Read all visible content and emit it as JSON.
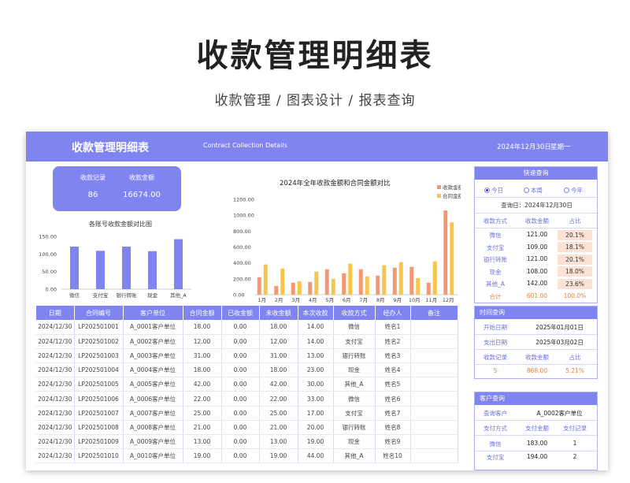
{
  "hero": {
    "title": "收款管理明细表",
    "subtitle": "收款管理 / 图表设计 / 报表查询"
  },
  "banner": {
    "title": "收款管理明细表",
    "en": "Contract Collection Details",
    "date": "2024年12月30日",
    "weekday": "星期一"
  },
  "summary": {
    "count_label": "收款记录",
    "amount_label": "收款金额",
    "count": "86",
    "amount": "16674.00"
  },
  "bar_chart_title": "各账号收款金额对比图",
  "combo_chart_title": "2024年全年收款金额和合同金额对比",
  "chart_data": [
    {
      "type": "bar",
      "title": "各账号收款金额对比图",
      "categories": [
        "微信",
        "支付宝",
        "银行转账",
        "现金",
        "其他_A"
      ],
      "values": [
        121,
        109,
        121,
        108,
        142
      ],
      "ylim": [
        0,
        150
      ],
      "yticks": [
        "0.00",
        "50.00",
        "100.00",
        "150.00"
      ],
      "color": "#7f84f1"
    },
    {
      "type": "bar",
      "title": "2024年全年收款金额和合同金额对比",
      "categories": [
        "1月",
        "2月",
        "3月",
        "4月",
        "5月",
        "6月",
        "7月",
        "8月",
        "9月",
        "10月",
        "11月",
        "12月"
      ],
      "series": [
        {
          "name": "收款金额",
          "color": "#f19875",
          "values": [
            220,
            110,
            150,
            160,
            320,
            270,
            320,
            240,
            340,
            350,
            150,
            1060
          ]
        },
        {
          "name": "合同金额",
          "color": "#f7c54b",
          "values": [
            380,
            330,
            170,
            290,
            200,
            390,
            230,
            370,
            410,
            210,
            420,
            910
          ]
        }
      ],
      "ylim": [
        0,
        1200
      ],
      "yticks": [
        "0.00",
        "200.00",
        "400.00",
        "600.00",
        "800.00",
        "1000.00",
        "1200.00"
      ],
      "legend": "top-right"
    }
  ],
  "table": {
    "headers": [
      "日期",
      "合同编号",
      "客户单位",
      "合同金额",
      "已收金额",
      "未收金额",
      "本次收款",
      "收款方式",
      "经办人",
      "备注"
    ],
    "rows": [
      [
        "2024/12/30",
        "LP202501001",
        "A_0001客户单位",
        "18.00",
        "0.00",
        "18.00",
        "14.00",
        "微信",
        "姓名1",
        ""
      ],
      [
        "2024/12/30",
        "LP202501002",
        "A_0002客户单位",
        "12.00",
        "0.00",
        "12.00",
        "14.00",
        "支付宝",
        "姓名2",
        ""
      ],
      [
        "2024/12/30",
        "LP202501003",
        "A_0003客户单位",
        "31.00",
        "0.00",
        "31.00",
        "13.00",
        "银行转账",
        "姓名3",
        ""
      ],
      [
        "2024/12/30",
        "LP202501004",
        "A_0004客户单位",
        "18.00",
        "0.00",
        "18.00",
        "23.00",
        "现金",
        "姓名4",
        ""
      ],
      [
        "2024/12/30",
        "LP202501005",
        "A_0005客户单位",
        "42.00",
        "0.00",
        "42.00",
        "30.00",
        "其他_A",
        "姓名5",
        ""
      ],
      [
        "2024/12/30",
        "LP202501006",
        "A_0006客户单位",
        "22.00",
        "0.00",
        "22.00",
        "33.00",
        "微信",
        "姓名6",
        ""
      ],
      [
        "2024/12/30",
        "LP202501007",
        "A_0007客户单位",
        "25.00",
        "0.00",
        "25.00",
        "17.00",
        "支付宝",
        "姓名7",
        ""
      ],
      [
        "2024/12/30",
        "LP202501008",
        "A_0008客户单位",
        "21.00",
        "0.00",
        "21.00",
        "20.00",
        "银行转账",
        "姓名8",
        ""
      ],
      [
        "2024/12/30",
        "LP202501009",
        "A_0009客户单位",
        "13.00",
        "0.00",
        "13.00",
        "19.00",
        "现金",
        "姓名9",
        ""
      ],
      [
        "2024/12/30",
        "LP202501010",
        "A_0010客户单位",
        "19.00",
        "0.00",
        "19.00",
        "44.00",
        "其他_A",
        "姓名10",
        ""
      ]
    ]
  },
  "quick": {
    "title": "快速查询",
    "radios": [
      {
        "label": "今日",
        "selected": true
      },
      {
        "label": "本周",
        "selected": false
      },
      {
        "label": "今年",
        "selected": false
      }
    ],
    "query_date": "查询日：2024年12月30日",
    "headers": [
      "收款方式",
      "收款金额",
      "占比"
    ],
    "rows": [
      [
        "微信",
        "121.00",
        "20.1%"
      ],
      [
        "支付宝",
        "109.00",
        "18.1%"
      ],
      [
        "银行转账",
        "121.00",
        "20.1%"
      ],
      [
        "现金",
        "108.00",
        "18.0%"
      ],
      [
        "其他_A",
        "142.00",
        "23.6%"
      ]
    ],
    "total": [
      "合计",
      "601.00",
      "100.0%"
    ]
  },
  "time_query": {
    "title": "时间查询",
    "start_label": "开始日期",
    "start_value": "2025年01月01日",
    "end_label": "支出日期",
    "end_value": "2025年03月02日",
    "headers": [
      "收款记录",
      "收款金额",
      "占比"
    ],
    "values": [
      "5",
      "868.00",
      "5.21%"
    ]
  },
  "customer_query": {
    "title": "客户查询",
    "label": "查询客户",
    "value": "A_0002客户单位",
    "headers": [
      "支付方式",
      "支付金额",
      "支付记录"
    ],
    "rows": [
      [
        "微信",
        "183.00",
        "1"
      ],
      [
        "支付宝",
        "194.00",
        "2"
      ]
    ]
  },
  "colors": {
    "accent": "#7f84f1",
    "orange": "#f19875",
    "yellow": "#f7c54b",
    "highlight": "#fbe2d5",
    "total": "#e8833a"
  }
}
